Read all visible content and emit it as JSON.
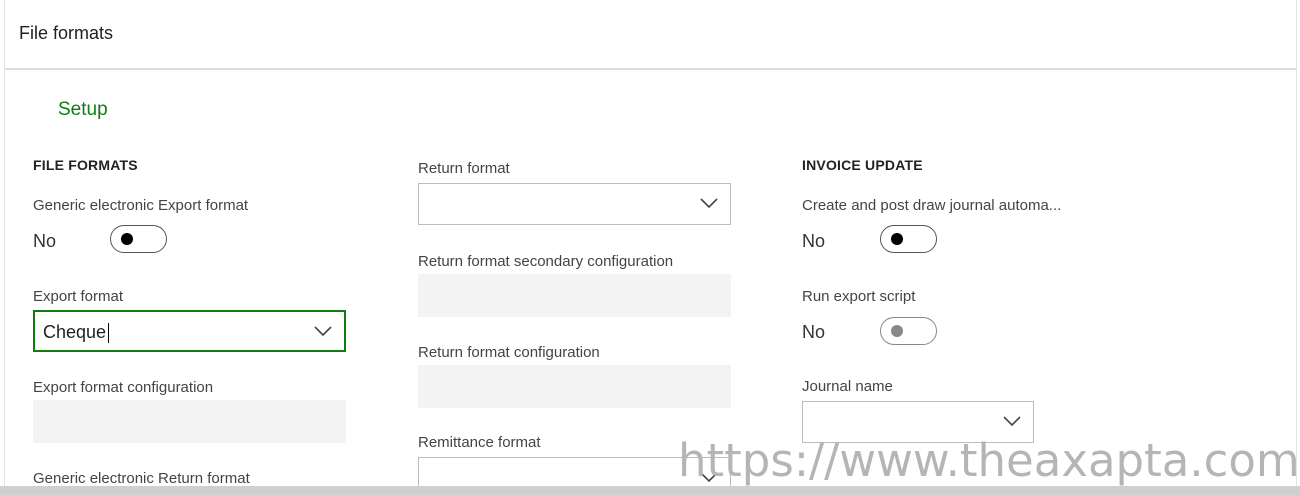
{
  "header": {
    "title": "File formats"
  },
  "tabs": {
    "active": "Setup"
  },
  "file_formats": {
    "heading": "FILE FORMATS",
    "generic_export": {
      "label": "Generic electronic Export format",
      "value_text": "No"
    },
    "export_format": {
      "label": "Export format",
      "value": "Cheque"
    },
    "export_format_config": {
      "label": "Export format configuration"
    },
    "generic_return": {
      "label": "Generic electronic Return format"
    }
  },
  "return": {
    "return_format": {
      "label": "Return format",
      "value": ""
    },
    "return_secondary": {
      "label": "Return format secondary configuration"
    },
    "return_config": {
      "label": "Return format configuration"
    },
    "remittance": {
      "label": "Remittance format",
      "value": ""
    }
  },
  "invoice_update": {
    "heading": "INVOICE UPDATE",
    "create_post": {
      "label": "Create and post draw journal automa...",
      "value_text": "No"
    },
    "run_export": {
      "label": "Run export script",
      "value_text": "No"
    },
    "journal_name": {
      "label": "Journal name",
      "value": ""
    }
  },
  "watermark": "https://www.theaxapta.com/",
  "colors": {
    "accent": "#107c10",
    "disabled_field": "#f3f3f3",
    "watermark": "#b5b5b5"
  },
  "icons": {
    "dropdown": "chevron-down-icon",
    "toggle_off": "toggle-off-icon"
  }
}
